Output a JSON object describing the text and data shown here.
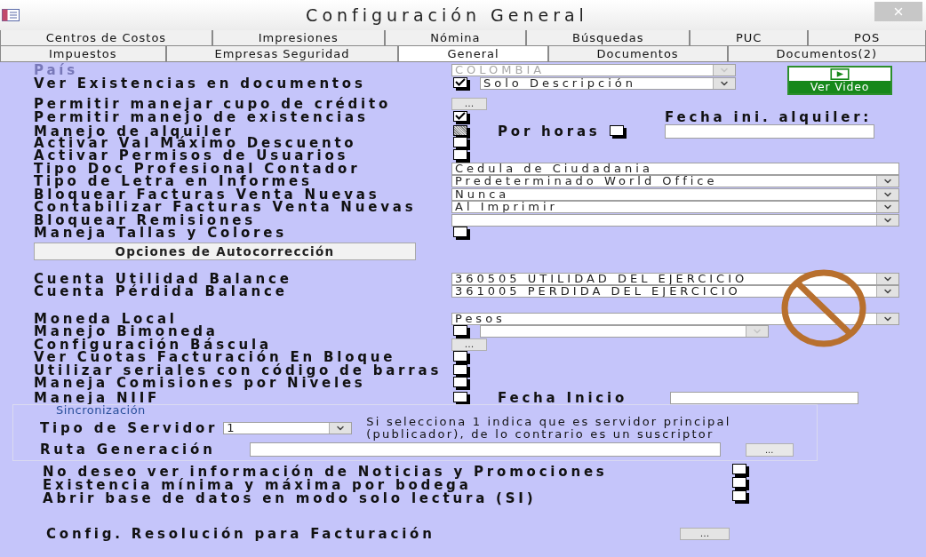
{
  "window": {
    "title": "Configuración General"
  },
  "tab_rows": [
    {
      "tabs": [
        {
          "label": "Centros de Costos",
          "selected": false
        },
        {
          "label": "Impresiones",
          "selected": false
        },
        {
          "label": "Nómina",
          "selected": false
        },
        {
          "label": "Búsquedas",
          "selected": false
        },
        {
          "label": "PUC",
          "selected": false
        },
        {
          "label": "POS",
          "selected": false
        }
      ]
    },
    {
      "tabs": [
        {
          "label": "Impuestos",
          "selected": false
        },
        {
          "label": "Empresas Seguridad",
          "selected": false
        },
        {
          "label": "General",
          "selected": true
        },
        {
          "label": "Documentos",
          "selected": false
        },
        {
          "label": "Documentos(2)",
          "selected": false
        }
      ]
    }
  ],
  "top": {
    "rows": [
      {
        "label": "País",
        "disabled": true,
        "controls": [
          {
            "kind": "combo",
            "value": "COLOMBIA",
            "disabled": true
          }
        ]
      },
      {
        "label": "Ver Existencias en documentos",
        "disabled": false,
        "controls": [
          {
            "kind": "checkbox",
            "checked": true,
            "mixed": false
          },
          {
            "kind": "combo",
            "value": "Solo Descripción",
            "disabled": false
          }
        ]
      }
    ],
    "video_button": {
      "label": "Ver Video"
    }
  },
  "sections": [
    {
      "rows": [
        {
          "label": "Permitir manejar cupo de crédito",
          "disabled": false,
          "controls": [
            {
              "kind": "ellipsis",
              "label": "..."
            }
          ]
        },
        {
          "label": "Permitir manejo de existencias",
          "disabled": false,
          "controls": [
            {
              "kind": "checkbox",
              "checked": true,
              "mixed": false
            }
          ],
          "aside": {
            "kind": "label",
            "text": "Fecha ini. alquiler:"
          }
        },
        {
          "label": "Manejo de alquiler",
          "disabled": false,
          "controls": [
            {
              "kind": "checkbox",
              "checked": false,
              "mixed": true
            },
            {
              "kind": "label",
              "text": "Por horas"
            },
            {
              "kind": "checkbox",
              "checked": false,
              "mixed": false
            }
          ],
          "aside": {
            "kind": "text"
          }
        },
        {
          "label": "Activar Val Máximo Descuento",
          "disabled": false,
          "controls": [
            {
              "kind": "checkbox",
              "checked": false,
              "mixed": false
            }
          ]
        },
        {
          "label": "Activar Permisos de Usuarios",
          "disabled": false,
          "controls": [
            {
              "kind": "checkbox",
              "checked": false,
              "mixed": false
            }
          ]
        },
        {
          "label": "Tipo Doc Profesional Contador",
          "disabled": false,
          "controls": [
            {
              "kind": "text",
              "value": "Cedula de Ciudadania"
            }
          ]
        },
        {
          "label": "Tipo de Letra en Informes",
          "disabled": false,
          "controls": [
            {
              "kind": "combo",
              "value": "Predeterminado World Office",
              "disabled": false
            }
          ]
        },
        {
          "label": "Bloquear Facturas Venta Nuevas",
          "disabled": false,
          "controls": [
            {
              "kind": "combo",
              "value": "Nunca",
              "disabled": false
            }
          ]
        },
        {
          "label": "Contabilizar Facturas  Venta Nuevas",
          "disabled": false,
          "controls": [
            {
              "kind": "combo",
              "value": "Al Imprimir",
              "disabled": false
            }
          ]
        },
        {
          "label": "Bloquear Remisiones",
          "disabled": false,
          "controls": [
            {
              "kind": "combo",
              "disabled": false
            }
          ]
        },
        {
          "label": "Maneja Tallas y Colores",
          "disabled": false,
          "controls": [
            {
              "kind": "checkbox",
              "checked": false,
              "mixed": false
            }
          ]
        }
      ],
      "button": {
        "label": "Opciones de Autocorrección"
      }
    },
    {
      "rows": [
        {
          "label": "Cuenta Utilidad Balance",
          "disabled": false,
          "controls": [
            {
              "kind": "combo",
              "value": "360505 UTILIDAD DEL EJERCICIO",
              "disabled": false
            }
          ]
        },
        {
          "label": "Cuenta Pérdida Balance",
          "disabled": false,
          "controls": [
            {
              "kind": "combo",
              "value": "361005 PERDIDA DEL EJERCICIO",
              "disabled": false
            }
          ]
        }
      ]
    },
    {
      "rows": [
        {
          "label": "Moneda Local",
          "disabled": false,
          "controls": [
            {
              "kind": "combo",
              "value": "Pesos",
              "disabled": false
            }
          ]
        },
        {
          "label": "Manejo Bimoneda",
          "disabled": false,
          "controls": [
            {
              "kind": "checkbox",
              "checked": false,
              "mixed": false
            },
            {
              "kind": "combo",
              "disabled": true
            }
          ]
        },
        {
          "label": "Configuración Báscula",
          "disabled": false,
          "controls": [
            {
              "kind": "ellipsis",
              "label": "..."
            }
          ]
        },
        {
          "label": "Ver Cuotas Facturación En Bloque",
          "disabled": false,
          "controls": [
            {
              "kind": "checkbox",
              "checked": false,
              "mixed": false
            }
          ]
        },
        {
          "label": "Utilizar seriales con código de barras",
          "disabled": false,
          "controls": [
            {
              "kind": "checkbox",
              "checked": false,
              "mixed": false
            }
          ]
        },
        {
          "label": "Maneja Comisiones por Niveles",
          "disabled": false,
          "controls": [
            {
              "kind": "checkbox",
              "checked": false,
              "mixed": false
            }
          ]
        },
        {
          "label": "Maneja NIIF",
          "disabled": false,
          "controls": [
            {
              "kind": "checkbox",
              "checked": false,
              "mixed": false
            },
            {
              "kind": "label",
              "text": "Fecha Inicio"
            },
            {
              "kind": "text"
            }
          ]
        }
      ]
    }
  ],
  "sync": {
    "legend": "Sincronización",
    "server_label": "Tipo de Servidor",
    "server_value": "1",
    "note": "Si selecciona 1 indica que es servidor principal (publicador), de lo contrario es un suscriptor",
    "route_label": "Ruta Generación",
    "route_button": "..."
  },
  "options": [
    {
      "label": "No deseo ver información de Noticias y Promociones",
      "checked": false,
      "mixed": false
    },
    {
      "label": "Existencia mínima y máxima por bodega",
      "checked": false,
      "mixed": false
    },
    {
      "label": "Abrir base de datos en modo solo lectura (SI)",
      "checked": false,
      "mixed": false
    }
  ],
  "resolution": {
    "label": "Config. Resolución para Facturación",
    "button": "..."
  }
}
